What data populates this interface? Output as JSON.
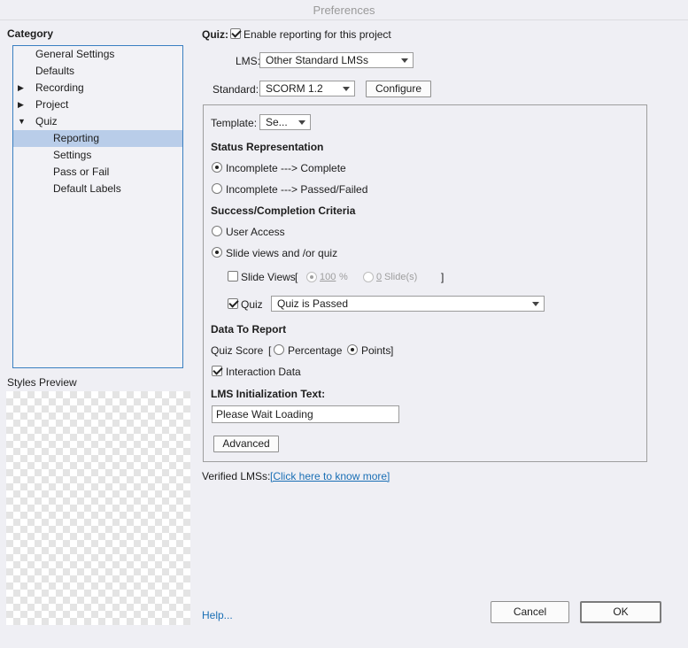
{
  "window": {
    "title": "Preferences"
  },
  "category": {
    "label": "Category",
    "items": [
      {
        "label": "General Settings",
        "expander": ""
      },
      {
        "label": "Defaults",
        "expander": ""
      },
      {
        "label": "Recording",
        "expander": "▶"
      },
      {
        "label": "Project",
        "expander": "▶"
      },
      {
        "label": "Quiz",
        "expander": "▼"
      },
      {
        "label": "Reporting",
        "expander": ""
      },
      {
        "label": "Settings",
        "expander": ""
      },
      {
        "label": "Pass or Fail",
        "expander": ""
      },
      {
        "label": "Default Labels",
        "expander": ""
      }
    ],
    "selected": "Reporting"
  },
  "styles_preview": {
    "label": "Styles Preview"
  },
  "quiz": {
    "label": "Quiz:",
    "enable_reporting": {
      "label": "Enable reporting for this project",
      "checked": true
    }
  },
  "lms": {
    "label": "LMS:",
    "value": "Other Standard LMSs"
  },
  "standard": {
    "label": "Standard:",
    "value": "SCORM 1.2",
    "configure_label": "Configure"
  },
  "template": {
    "label": "Template:",
    "value": "Se..."
  },
  "status_representation": {
    "heading": "Status Representation",
    "option1": "Incomplete ---> Complete",
    "option2": "Incomplete ---> Passed/Failed",
    "selected": "option1"
  },
  "criteria": {
    "heading": "Success/Completion Criteria",
    "user_access": "User Access",
    "slide_views_quiz": "Slide views and /or quiz",
    "selected": "slide_views_quiz",
    "slide_views": {
      "label": "Slide Views",
      "open_bracket": "[",
      "close_bracket": "]",
      "percent_value": "100",
      "percent_unit": "%",
      "slides_value": "0",
      "slides_unit": "Slide(s)",
      "checked": false
    },
    "quiz": {
      "label": "Quiz",
      "checked": true,
      "condition": "Quiz is Passed"
    }
  },
  "data_to_report": {
    "heading": "Data To Report",
    "quiz_score_label": "Quiz Score",
    "open_bracket": "[",
    "close_bracket": "]",
    "percentage": "Percentage",
    "points": "Points",
    "selected": "points",
    "interaction_data": {
      "label": "Interaction Data",
      "checked": true
    }
  },
  "lms_init": {
    "heading": "LMS Initialization Text:",
    "value": "Please Wait Loading"
  },
  "advanced_label": "Advanced",
  "verified": {
    "label": "Verified LMSs:",
    "link": "[Click here to know more]"
  },
  "footer": {
    "help": "Help...",
    "cancel": "Cancel",
    "ok": "OK"
  },
  "colors": {
    "accent": "#3a7fc1",
    "selection": "#b9cde9",
    "link": "#1a6fb5",
    "background": "#efeff4"
  }
}
